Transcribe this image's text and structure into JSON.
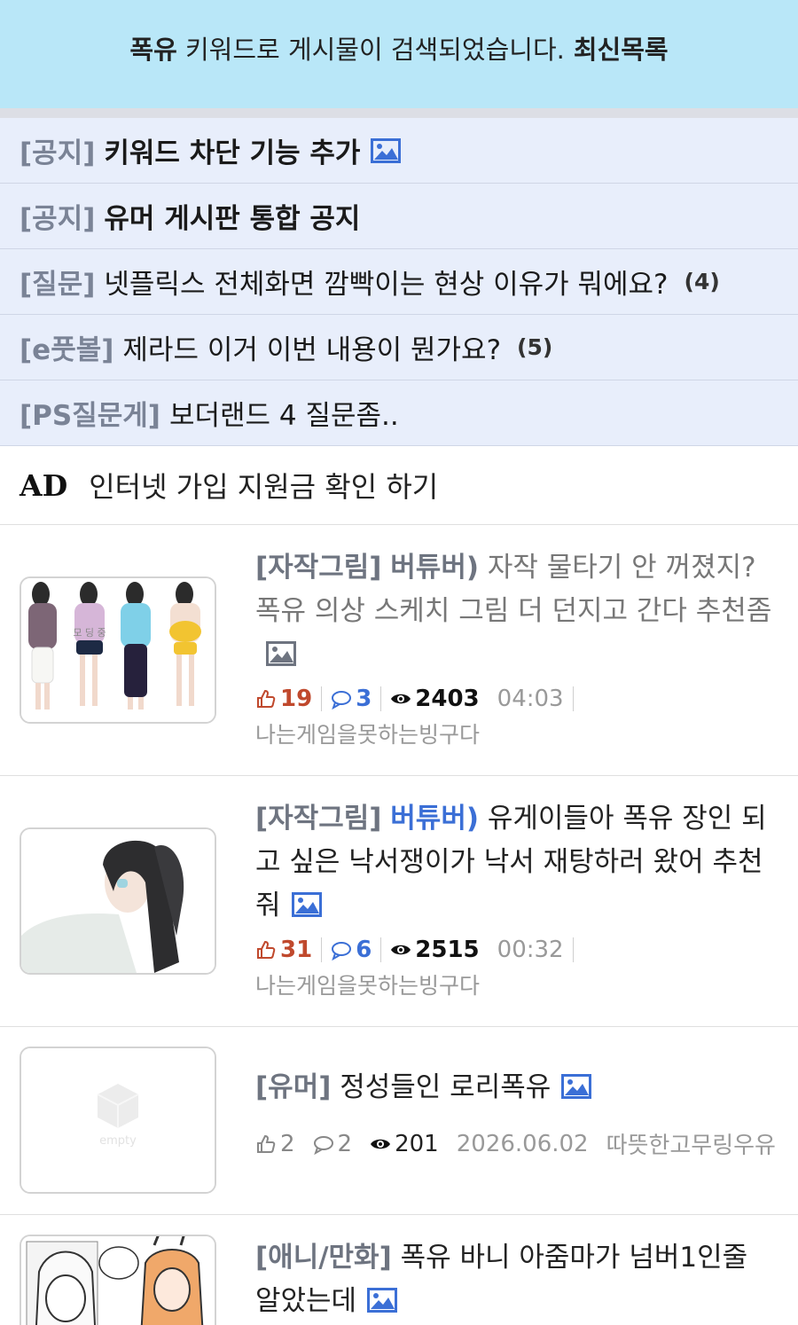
{
  "search_banner": {
    "keyword": "폭유",
    "message": " 키워드로 게시물이 검색되었습니다.",
    "latest_link": "최신목록"
  },
  "notices": [
    {
      "category": "[공지]",
      "title": "키워드 차단 기능 추가",
      "bold": true,
      "has_image": true,
      "count": ""
    },
    {
      "category": "[공지]",
      "title": "유머 게시판 통합 공지",
      "bold": true,
      "has_image": false,
      "count": ""
    },
    {
      "category": "[질문]",
      "title": "넷플릭스 전체화면 깜빡이는 현상 이유가 뭐에요?",
      "bold": false,
      "has_image": false,
      "count": "(4)"
    },
    {
      "category": "[e풋볼]",
      "title": "제라드 이거 이번 내용이 뭔가요?",
      "bold": false,
      "has_image": false,
      "count": "(5)"
    },
    {
      "category": "[PS질문게]",
      "title": "보더랜드 4 질문좀..",
      "bold": false,
      "has_image": false,
      "count": ""
    }
  ],
  "ad": {
    "tag": "AD",
    "text": "인터넷 가입 지원금 확인 하기"
  },
  "posts": [
    {
      "category": "[자작그림]",
      "subcategory": "버튜버)",
      "title": "자작 물타기 안 꺼졌지? 폭유 의상 스케치 그림 더 던지고 간다 추천좀",
      "likes": "19",
      "comments": "3",
      "views": "2403",
      "time": "04:03",
      "author": "나는게임을못하는빙구다",
      "thumb_text": "모 딩 중"
    },
    {
      "category": "[자작그림]",
      "subcategory": "버튜버)",
      "title": "유게이들아 폭유 장인 되고 싶은 낙서쟁이가 낙서 재탕하러 왔어 추천줘",
      "likes": "31",
      "comments": "6",
      "views": "2515",
      "time": "00:32",
      "author": "나는게임을못하는빙구다"
    },
    {
      "category": "[유머]",
      "title": "정성들인 로리폭유",
      "likes": "2",
      "comments": "2",
      "views": "201",
      "time": "2026.06.02",
      "author": "따뜻한고무링우유",
      "thumb_text": "empty"
    },
    {
      "category": "[애니/만화]",
      "title": "폭유 바니 아줌마가 넘버1인줄 알았는데"
    }
  ],
  "colors": {
    "banner_bg": "#b9e7f8",
    "notice_bg": "#e8eefb",
    "like_color": "#c0492d",
    "comment_color": "#3b6fd6",
    "image_icon_color": "#3b6fd6"
  },
  "icons": [
    "image-icon",
    "thumbs-up-icon",
    "comment-icon",
    "eye-icon"
  ]
}
